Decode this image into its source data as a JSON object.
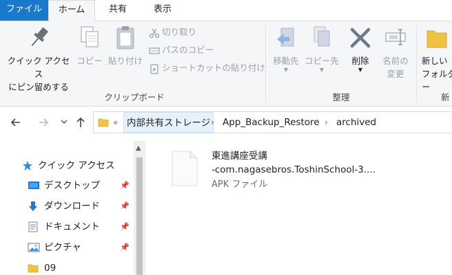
{
  "tabs": {
    "file": "ファイル",
    "home": "ホーム",
    "share": "共有",
    "view": "表示"
  },
  "ribbon": {
    "clipboard": {
      "pin_line1": "クイック アクセス",
      "pin_line2": "にピン留めする",
      "copy": "コピー",
      "paste": "貼り付け",
      "cut": "切り取り",
      "copy_path": "パスのコピー",
      "paste_shortcut": "ショートカットの貼り付け",
      "label": "クリップボード"
    },
    "organize": {
      "move_to": "移動先",
      "copy_to": "コピー先",
      "delete": "削除",
      "rename_line1": "名前の",
      "rename_line2": "変更",
      "label": "整理"
    },
    "new": {
      "new_folder_line1": "新しい",
      "new_folder_line2": "フォルダー",
      "label": "新"
    }
  },
  "address": {
    "overflow": "«",
    "crumbs": [
      "内部共有ストレージ",
      "App_Backup_Restore",
      "archived"
    ]
  },
  "navpane": {
    "items": [
      {
        "label": "クイック アクセス"
      },
      {
        "label": "デスクトップ"
      },
      {
        "label": "ダウンロード"
      },
      {
        "label": "ドキュメント"
      },
      {
        "label": "ピクチャ"
      },
      {
        "label": "09"
      }
    ]
  },
  "files": [
    {
      "name_line1": "東進講座受講",
      "name_line2": "-com.nagasebros.ToshinSchool-3....",
      "type": "APK ファイル"
    }
  ],
  "colors": {
    "accent": "#1979ca",
    "ribbon_bg": "#f5f6f7",
    "crumb_highlight": "#e5f1fb"
  }
}
